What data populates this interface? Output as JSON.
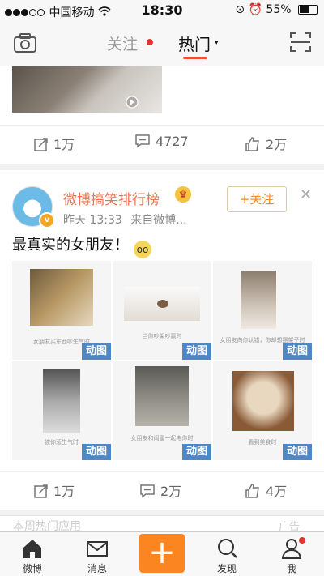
{
  "status_bar": {
    "carrier": "中国移动",
    "time": "18:30",
    "battery": "55%"
  },
  "nav": {
    "tab_follow": "关注",
    "tab_hot": "热门",
    "caret": "▾"
  },
  "post1": {
    "repost_count": "1万",
    "comment_count": "4727",
    "like_count": "2万"
  },
  "post2": {
    "username": "微博搞笑排行榜",
    "time": "昨天 13:33",
    "source": "来自微博...",
    "follow_label": "+关注",
    "text": "最真实的女朋友！",
    "grid": [
      {
        "caption": "女朋友买东西吵生气时",
        "tag": "动图"
      },
      {
        "caption": "当你吵架吵赢时",
        "tag": "动图"
      },
      {
        "caption": "女朋友向你认错，你却想摆架子时",
        "tag": "动图"
      },
      {
        "caption": "被你惹生气时",
        "tag": "动图"
      },
      {
        "caption": "女朋友和闺蜜一起电你时",
        "tag": "动图"
      },
      {
        "caption": "看到美食时",
        "tag": "动图"
      }
    ],
    "repost_count": "1万",
    "comment_count": "2万",
    "like_count": "4万"
  },
  "post3": {
    "title_partial": "本周热门应用",
    "ad_label": "广告"
  },
  "tab_bar": {
    "home": "微博",
    "messages": "消息",
    "compose": "+",
    "discover": "发现",
    "me": "我"
  },
  "colors": {
    "accent_orange": "#fb8520",
    "username_orange": "#eb7350",
    "tag_blue": "#4f86c6",
    "badge_red": "#e6322e"
  }
}
